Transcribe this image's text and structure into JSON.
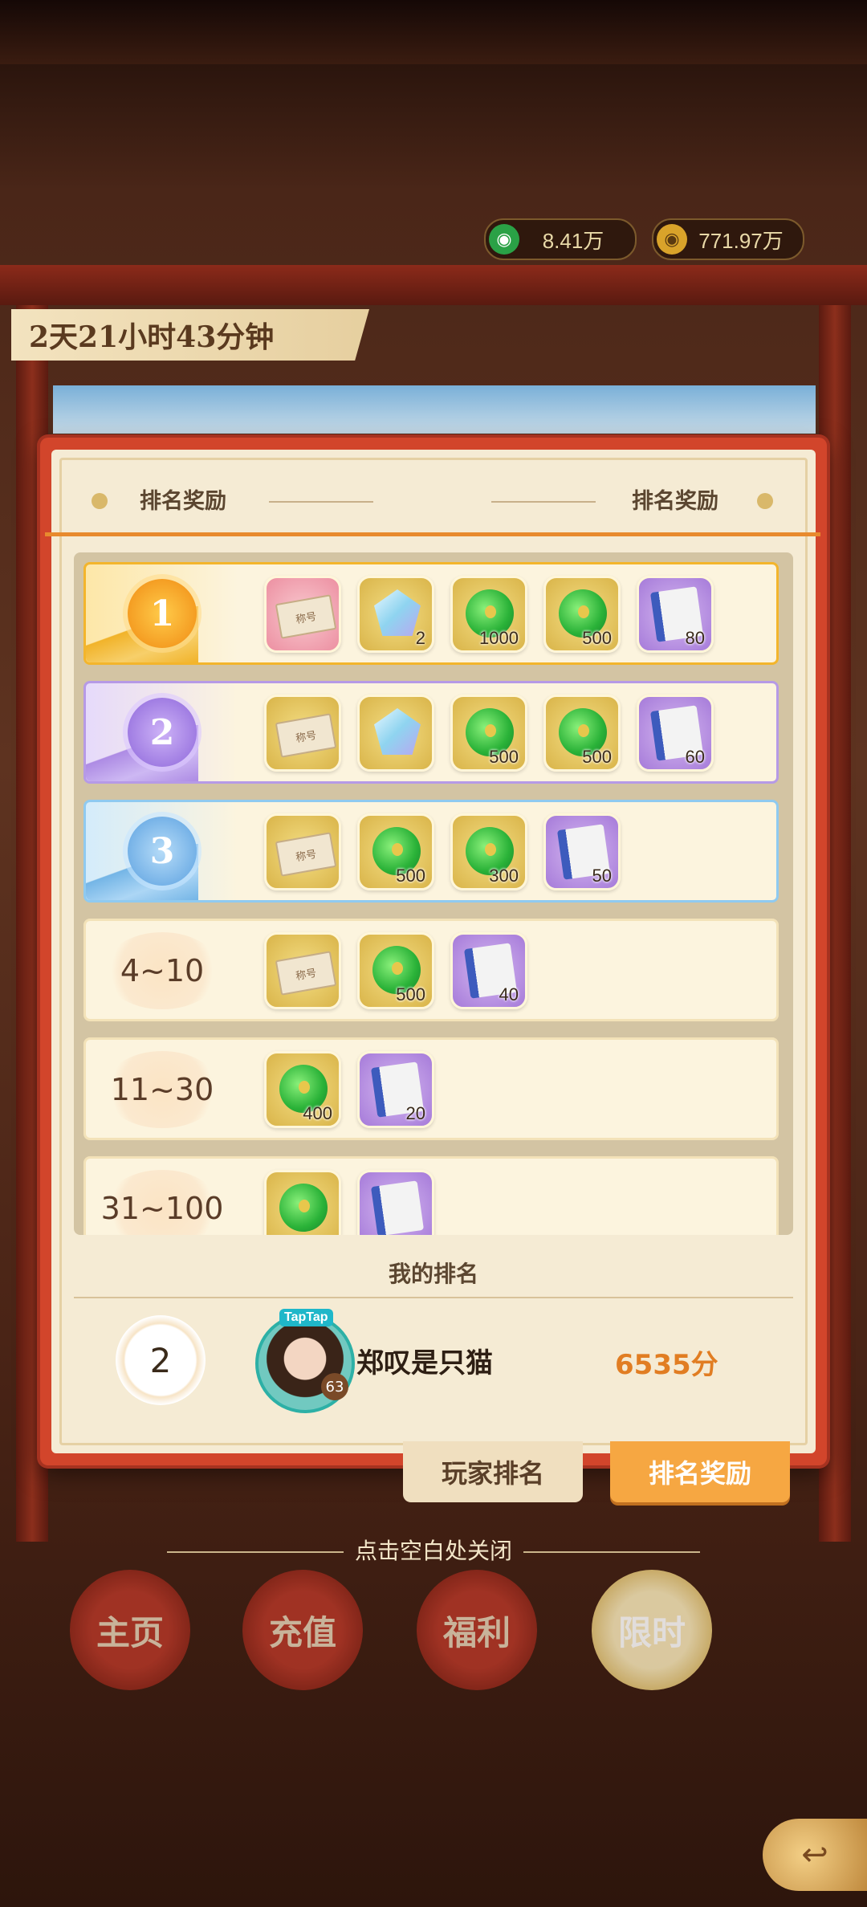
{
  "currencies": [
    {
      "icon": "jade-coin-icon",
      "value": "8.41万"
    },
    {
      "icon": "gold-coin-icon",
      "value": "771.97万"
    }
  ],
  "timer": "2天21小时43分钟",
  "panel": {
    "header_left": "排名奖励",
    "header_right": "排名奖励"
  },
  "rewards": [
    {
      "rank": "1",
      "items": [
        {
          "type": "title-ticket",
          "label": "称号",
          "qty": ""
        },
        {
          "type": "gem",
          "qty": "2"
        },
        {
          "type": "jade",
          "qty": "1000"
        },
        {
          "type": "jade",
          "qty": "500"
        },
        {
          "type": "book",
          "qty": "80"
        }
      ]
    },
    {
      "rank": "2",
      "items": [
        {
          "type": "title-ticket",
          "label": "称号",
          "qty": ""
        },
        {
          "type": "gem",
          "qty": ""
        },
        {
          "type": "jade",
          "qty": "500"
        },
        {
          "type": "jade",
          "qty": "500"
        },
        {
          "type": "book",
          "qty": "60"
        }
      ]
    },
    {
      "rank": "3",
      "items": [
        {
          "type": "title-ticket",
          "label": "称号",
          "qty": ""
        },
        {
          "type": "jade",
          "qty": "500"
        },
        {
          "type": "jade",
          "qty": "300"
        },
        {
          "type": "book",
          "qty": "50"
        }
      ]
    },
    {
      "rank": "4~10",
      "items": [
        {
          "type": "title-ticket",
          "label": "称号",
          "qty": ""
        },
        {
          "type": "jade",
          "qty": "500"
        },
        {
          "type": "book",
          "qty": "40"
        }
      ]
    },
    {
      "rank": "11~30",
      "items": [
        {
          "type": "jade",
          "qty": "400"
        },
        {
          "type": "book",
          "qty": "20"
        }
      ]
    },
    {
      "rank": "31~100",
      "items": [
        {
          "type": "jade",
          "qty": ""
        },
        {
          "type": "book",
          "qty": ""
        }
      ]
    }
  ],
  "my_rank": {
    "title": "我的排名",
    "rank": "2",
    "avatar_tag": "TapTap",
    "level": "63",
    "name": "郑叹是只猫",
    "score": "6535分"
  },
  "tabs": {
    "players": "玩家排名",
    "rewards": "排名奖励"
  },
  "close_hint": "点击空白处关闭",
  "nav": [
    {
      "label": "主页"
    },
    {
      "label": "充值"
    },
    {
      "label": "福利"
    },
    {
      "label": "限时"
    }
  ]
}
